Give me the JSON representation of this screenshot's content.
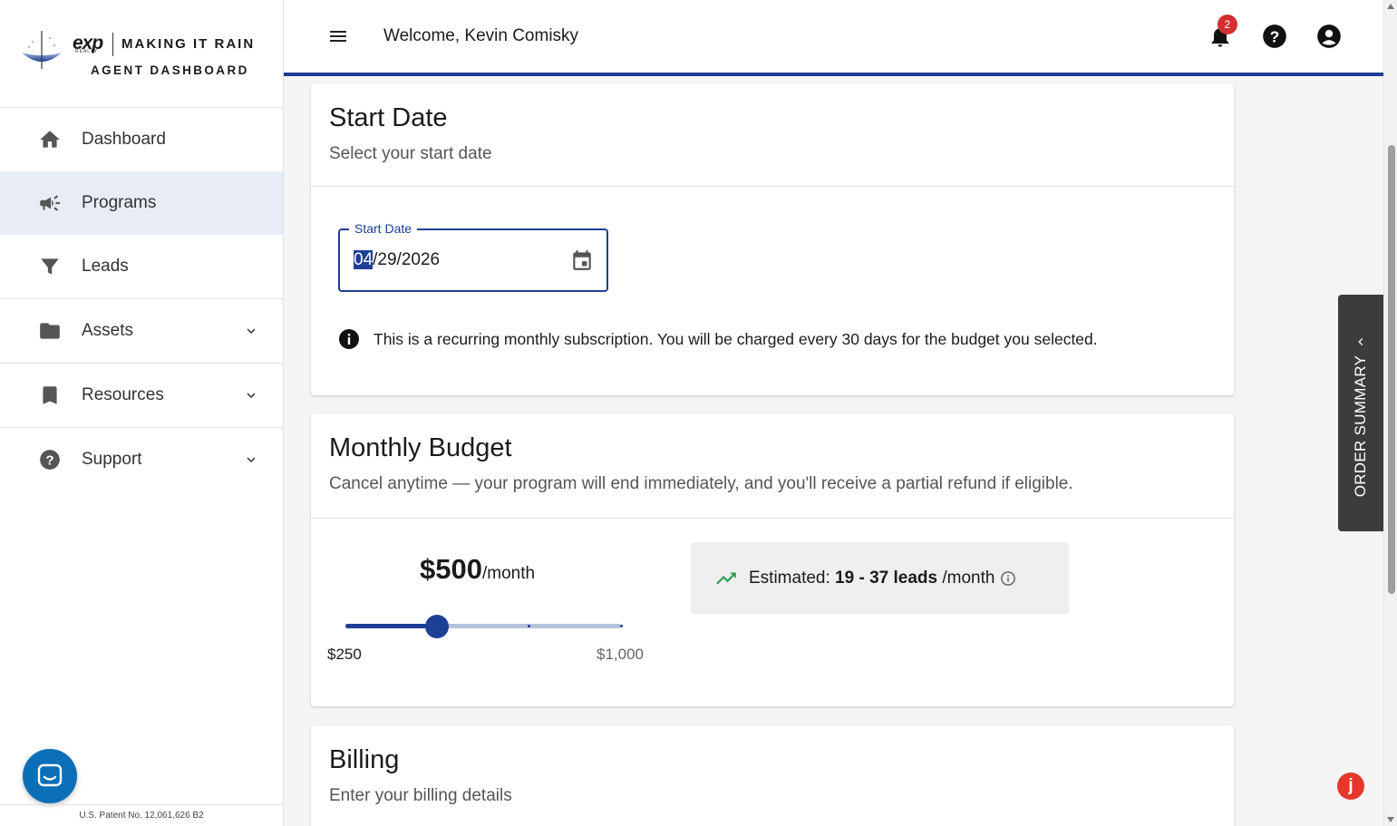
{
  "brand": {
    "logo_exp": "exp",
    "logo_realty": "REALTY",
    "title_line1": "MAKING IT RAIN",
    "title_line2": "AGENT DASHBOARD"
  },
  "header": {
    "welcome": "Welcome, Kevin Comisky",
    "notification_count": "2"
  },
  "sidebar": {
    "items": [
      {
        "label": "Dashboard",
        "icon": "home-icon"
      },
      {
        "label": "Programs",
        "icon": "megaphone-icon",
        "active": true
      },
      {
        "label": "Leads",
        "icon": "funnel-icon"
      },
      {
        "label": "Assets",
        "icon": "folder-icon",
        "expandable": true
      },
      {
        "label": "Resources",
        "icon": "bookmark-icon",
        "expandable": true
      },
      {
        "label": "Support",
        "icon": "help-circle-icon",
        "expandable": true
      }
    ],
    "patent": "U.S. Patent No. 12,061,626 B2"
  },
  "start_date": {
    "title": "Start Date",
    "subtitle": "Select your start date",
    "field_label": "Start Date",
    "value_month": "04",
    "value_rest": "/29/2026",
    "notice": "This is a recurring monthly subscription. You will be charged every 30 days for the budget you selected."
  },
  "budget": {
    "title": "Monthly Budget",
    "subtitle": "Cancel anytime — your program will end immediately, and you'll receive a partial refund if eligible.",
    "amount": "$500",
    "per": "/month",
    "min_label": "$250",
    "max_label": "$1,000",
    "slider_min": 250,
    "slider_max": 1000,
    "slider_value": 500,
    "slider_ticks": [
      750,
      1000
    ],
    "estimate_prefix": "Estimated: ",
    "estimate_range": "19 - 37 leads",
    "estimate_suffix": " /month"
  },
  "billing": {
    "title": "Billing",
    "subtitle": "Enter your billing details"
  },
  "order_summary": {
    "label": "ORDER SUMMARY"
  },
  "colors": {
    "primary": "#1d3f94",
    "active_bg": "#e8edf5",
    "trend_green": "#2e9e4f",
    "badge_red": "#d32f2f"
  }
}
